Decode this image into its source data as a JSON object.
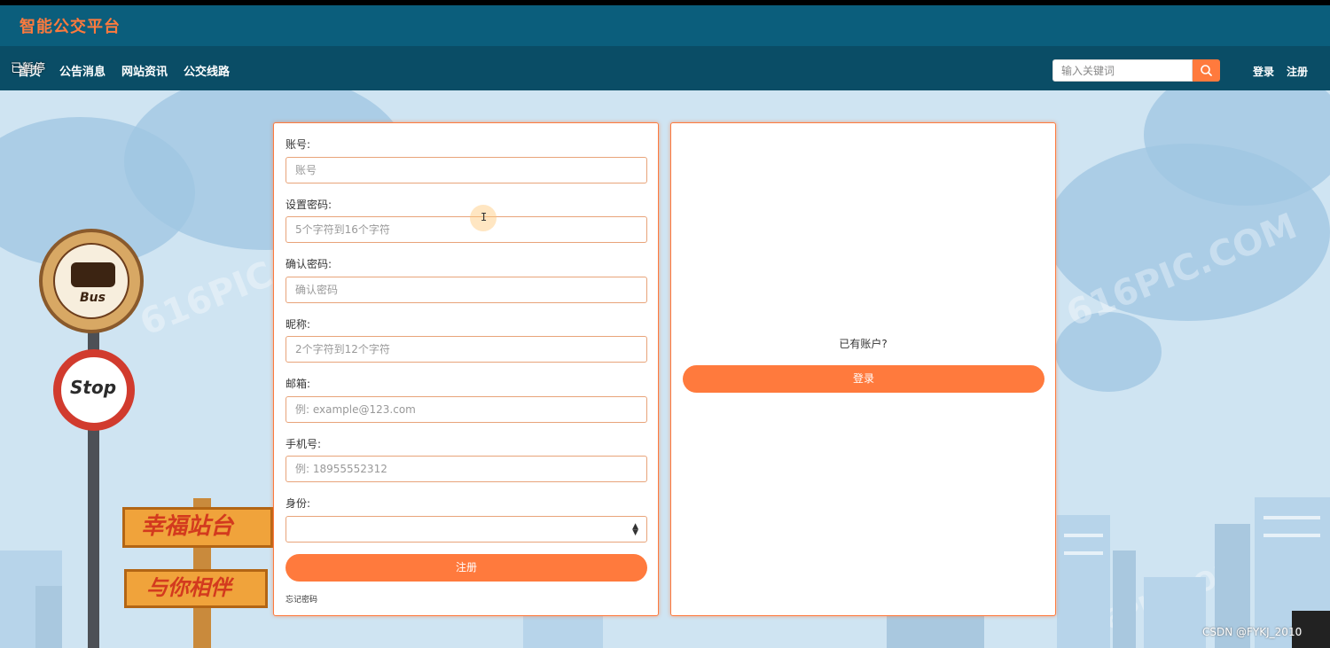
{
  "brand": {
    "title": "智能公交平台"
  },
  "overlay": {
    "paused_label": "已暂停"
  },
  "nav": {
    "items": [
      {
        "label": "首页"
      },
      {
        "label": "公告消息"
      },
      {
        "label": "网站资讯"
      },
      {
        "label": "公交线路"
      }
    ]
  },
  "search": {
    "placeholder": "输入关键词"
  },
  "auth": {
    "login": "登录",
    "register": "注册"
  },
  "register_form": {
    "fields": [
      {
        "label": "账号:",
        "placeholder": "账号"
      },
      {
        "label": "设置密码:",
        "placeholder": "5个字符到16个字符"
      },
      {
        "label": "确认密码:",
        "placeholder": "确认密码"
      },
      {
        "label": "昵称:",
        "placeholder": "2个字符到12个字符"
      },
      {
        "label": "邮箱:",
        "placeholder": "例: example@123.com"
      },
      {
        "label": "手机号:",
        "placeholder": "例: 18955552312"
      }
    ],
    "identity": {
      "label": "身份:",
      "selected": ""
    },
    "submit_label": "注册",
    "forgot_label": "忘记密码"
  },
  "login_panel": {
    "prompt": "已有账户?",
    "login_label": "登录"
  },
  "scene": {
    "bus_sign_text": "Bus",
    "stop_sign_text": "Stop",
    "board_top": "幸福站台",
    "board_bottom": "与你相伴",
    "watermark": "616PIC.COM"
  },
  "footer": {
    "credit": "CSDN @FYKJ_2010"
  },
  "colors": {
    "brand_bar": "#0b5e7c",
    "nav_bar": "#0a4d66",
    "accent": "#ff7a3d"
  }
}
